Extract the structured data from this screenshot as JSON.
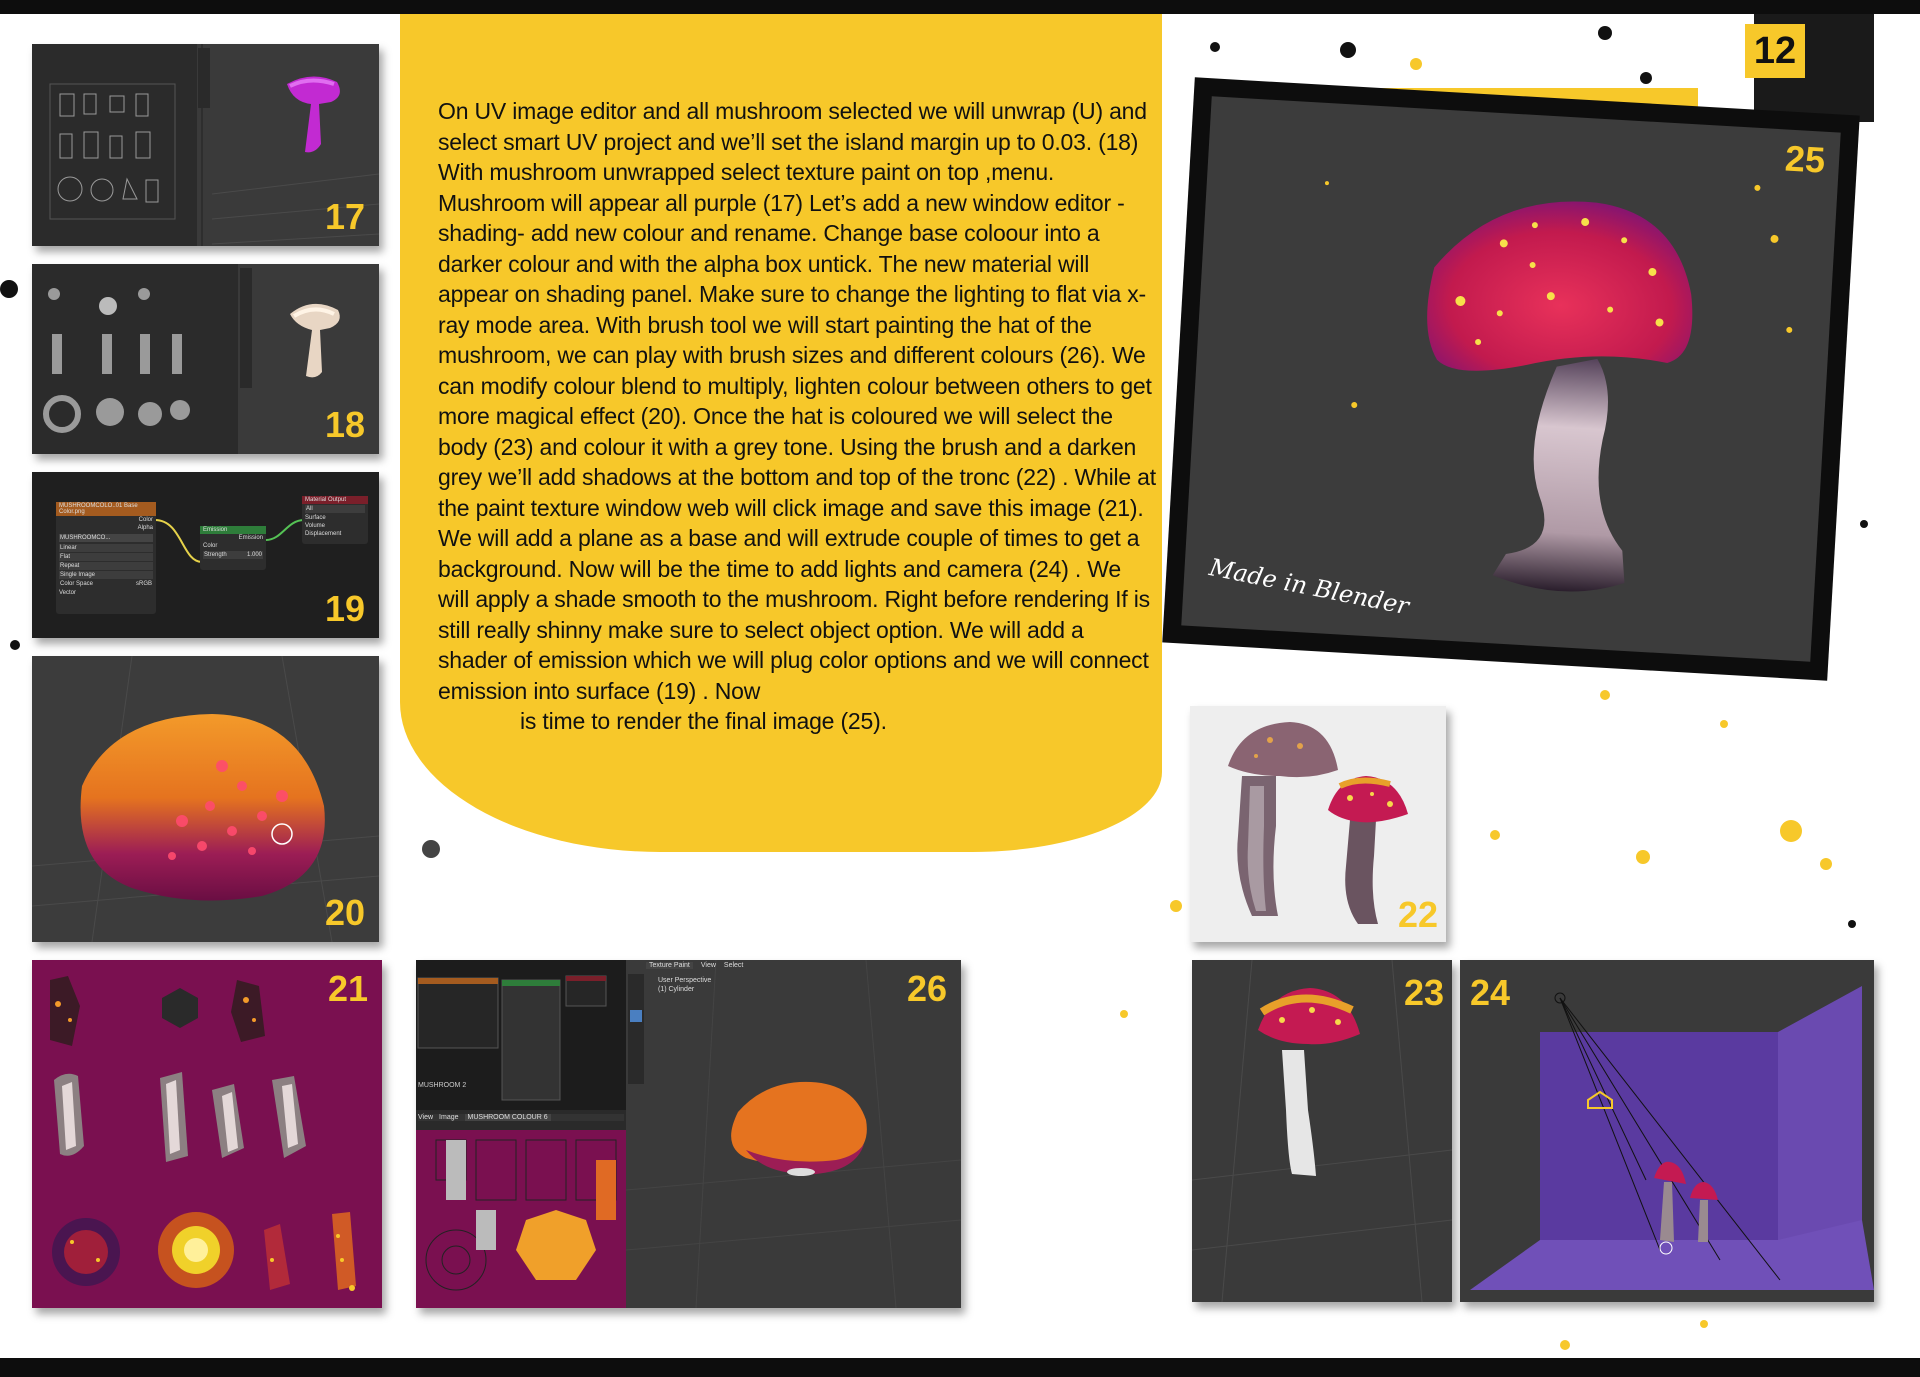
{
  "page_number": "12",
  "body_text": "On UV image editor and all mushroom selected we will unwrap (U) and select smart UV project and we’ll set the island margin up to 0.03. (18)  With mushroom unwrapped select texture paint on top ,menu. Mushroom will appear all purple (17) Let’s add a new window editor -shading-  add new colour  and rename. Change base coloour into a darker colour and with the alpha box untick. The new material will appear on shading panel.  Make sure to change the lighting to flat via x-ray mode area.  With brush tool we will start painting the hat of the mushroom, we can play with brush sizes and different colours (26). We can modify colour blend to multiply, lighten colour between others to get more magical effect (20). Once the hat is coloured we will select the body (23) and colour it with a grey tone. Using the brush and a darken grey we’ll add shadows at the bottom and top of the tronc (22) . While at the paint texture window web will click image and save this image (21). We will add a plane  as a base and will extrude couple of times to get a background.  Now will be the time to add lights and camera (24) . We will apply a shade smooth to the mushroom. Right before rendering If is still really shinny make sure to select object option. We will add a shader of emission which we will plug color options and we will connect emission into surface (19) . Now",
  "body_text_last": "is time to render the final image (25).",
  "figures": {
    "f17": "17",
    "f18": "18",
    "f19": "19",
    "f20": "20",
    "f21": "21",
    "f22": "22",
    "f23": "23",
    "f24": "24",
    "f25": "25",
    "f26": "26"
  },
  "signature": "Made in Blender",
  "node_editor": {
    "texture_node": "MUSHROOMCOLO..01 Base Color.png",
    "texture_field": "MUSHROOMCO...",
    "opt_linear": "Linear",
    "opt_flat": "Flat",
    "opt_repeat": "Repeat",
    "opt_single": "Single Image",
    "color_space_label": "Color Space",
    "color_space_value": "sRGB",
    "vector": "Vector",
    "out_color": "Color",
    "out_alpha": "Alpha",
    "emission_node": "Emission",
    "emission_out": "Emission",
    "emission_color": "Color",
    "emission_strength": "Strength",
    "emission_strength_value": "1.000",
    "output_node": "Material Output",
    "output_all": "All",
    "output_surface": "Surface",
    "output_volume": "Volume",
    "output_displacement": "Displacement"
  },
  "paint_ui": {
    "mode": "Texture Paint",
    "view": "View",
    "select": "Select",
    "perspective": "User Perspective",
    "object": "(1) Cylinder",
    "image_name": "MUSHROOM COLOUR 6",
    "image_view": "View",
    "image_menu": "Image",
    "material_label": "MUSHROOM 2"
  },
  "colors": {
    "accent_yellow": "#f7c82a",
    "ink_black": "#0d0d0d",
    "viewport_grey": "#3c3c3c",
    "magenta": "#7a1050"
  }
}
